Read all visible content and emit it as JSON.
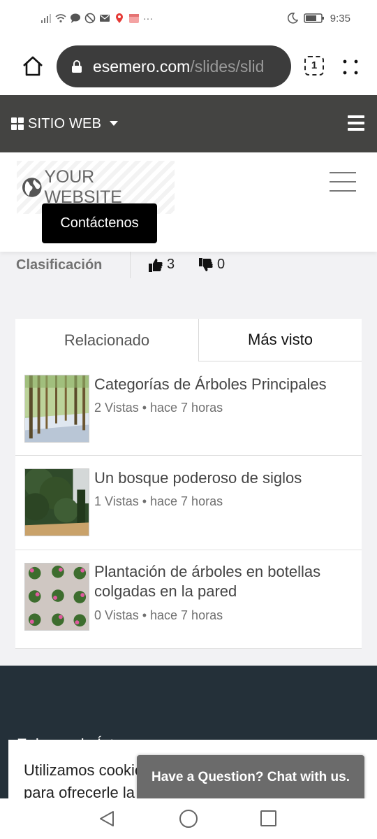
{
  "status_bar": {
    "time": "9:35",
    "left_icons": [
      "signal-icon",
      "wifi-icon",
      "chat-bubble-icon",
      "do-not-disturb-icon",
      "mail-icon",
      "location-icon",
      "calendar-icon",
      "more-icon"
    ],
    "more": "···",
    "right_icons": [
      "moon-icon",
      "battery-icon"
    ]
  },
  "browser": {
    "url_host": "esemero.com",
    "url_path": "/slides/slid",
    "tab_count": "1"
  },
  "site_nav": {
    "label": "SITIO WEB"
  },
  "header": {
    "logo_text": "YOUR WEBSITE",
    "contact_button": "Contáctenos"
  },
  "rating": {
    "label": "Clasificación",
    "likes": "3",
    "dislikes": "0"
  },
  "tabs": [
    {
      "label": "Relacionado",
      "active": true
    },
    {
      "label": "Más visto",
      "active": false
    }
  ],
  "items": [
    {
      "title": "Categorías de Árboles Principales",
      "meta": "2 Vistas • hace 7 horas"
    },
    {
      "title": "Un bosque poderoso de siglos",
      "meta": "1 Vistas • hace 7 horas"
    },
    {
      "title": "Plantación de árboles en botellas colgadas en la pared",
      "meta": "0 Vistas • hace 7 horas"
    }
  ],
  "footer": {
    "heading": "Enlaces de Íntes"
  },
  "cookie": {
    "text": "Utilizamos cookies para ofrecerle la mejor experiencia"
  },
  "chat": {
    "label": "Have a Question? Chat with us."
  },
  "colors": {
    "site_nav_bg": "#444442",
    "footer_bg": "#243039",
    "page_bg": "#f2f2f4",
    "chat_bg": "#6b6b6b"
  }
}
